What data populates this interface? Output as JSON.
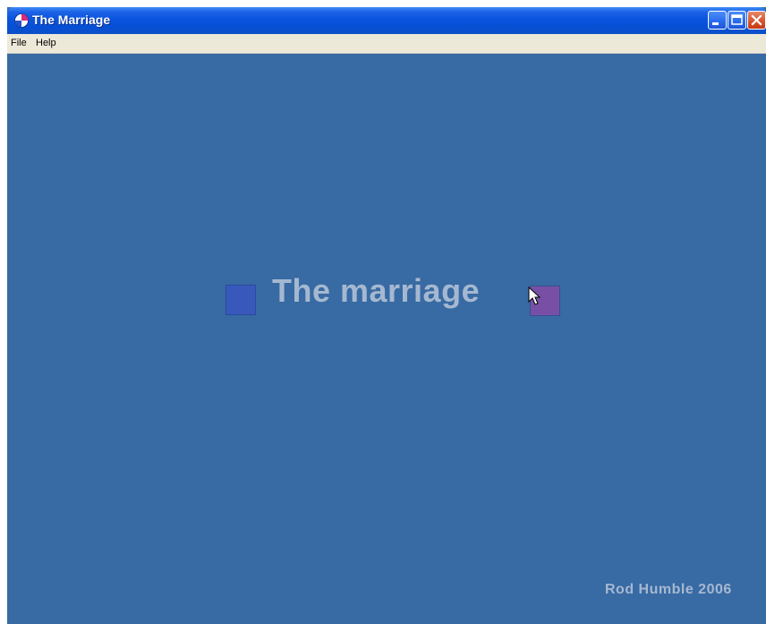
{
  "window": {
    "title": "The Marriage",
    "controls": [
      "minimize",
      "maximize",
      "close"
    ]
  },
  "menu": {
    "items": [
      "File",
      "Help"
    ]
  },
  "game": {
    "title": "The marriage",
    "credit": "Rod Humble 2006",
    "colors": {
      "background": "#386aa3",
      "blue_square": "#3958bb",
      "pink_square": "#7750a6",
      "text": "#a5b8d1"
    }
  },
  "icons": {
    "app": "app-icon",
    "cursor": "mouse-cursor-icon"
  }
}
